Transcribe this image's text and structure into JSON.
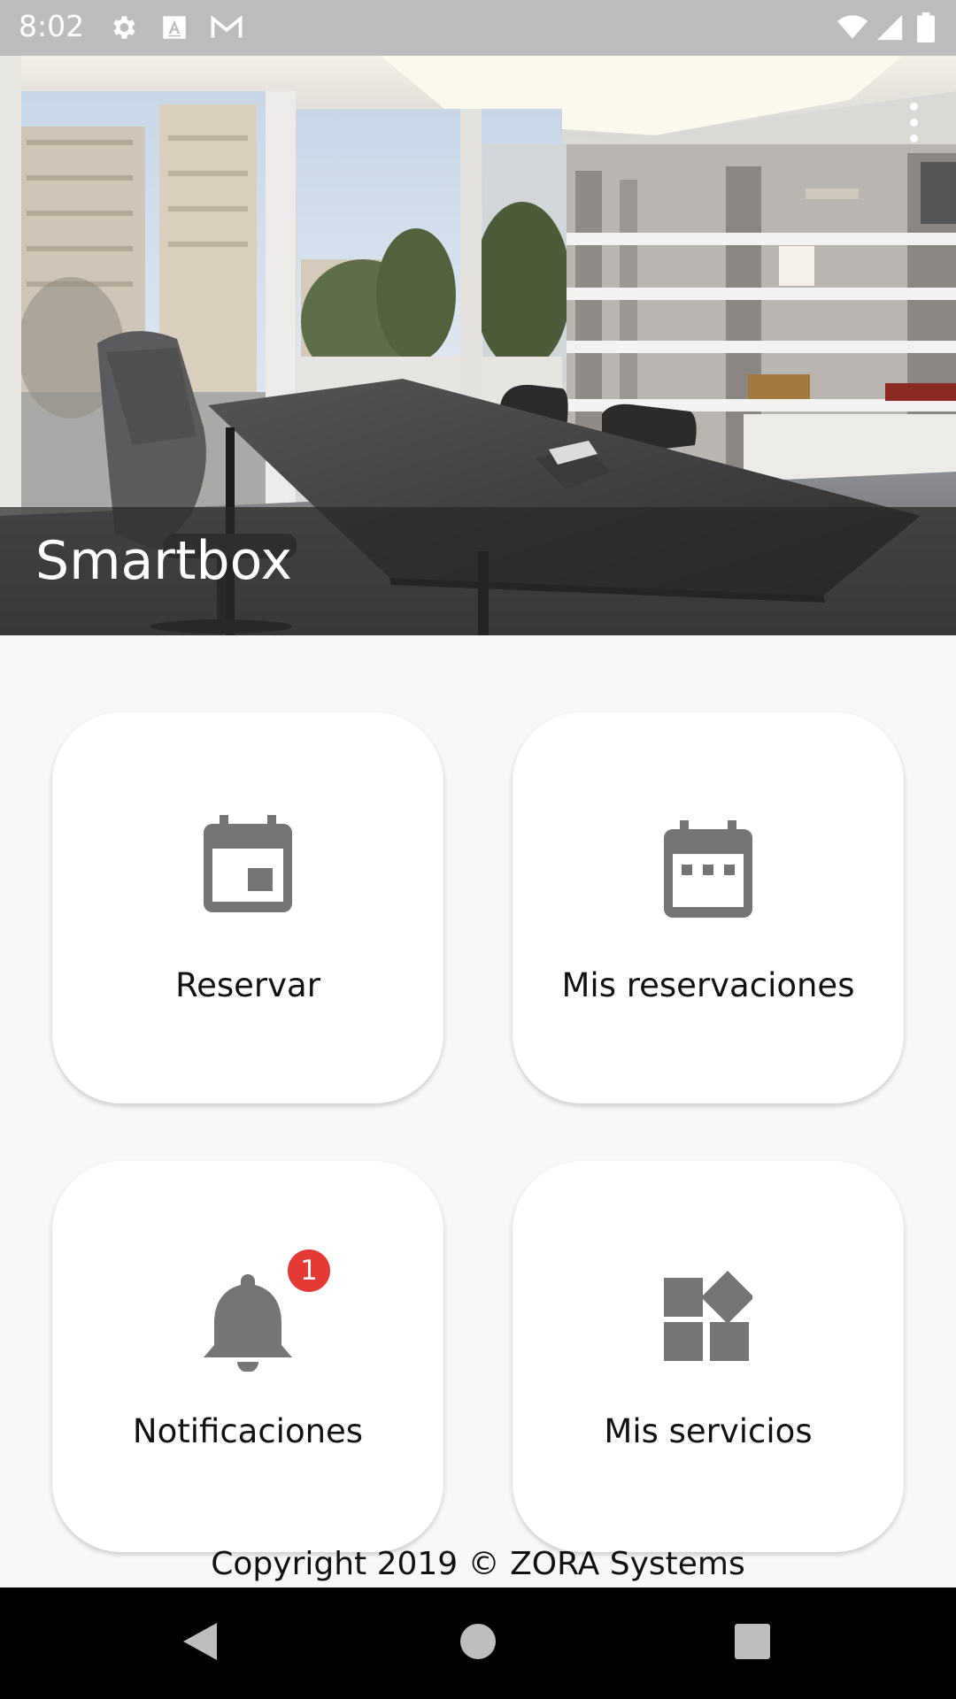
{
  "status_bar": {
    "time": "8:02",
    "left_icons": [
      "gear-icon",
      "font-a-icon",
      "gmail-icon"
    ],
    "right_icons": [
      "wifi-icon",
      "signal-icon",
      "battery-icon"
    ]
  },
  "header": {
    "title": "Smartbox",
    "menu_icon": "more-vert-icon"
  },
  "cards": [
    {
      "label": "Reservar",
      "icon": "calendar-today-icon"
    },
    {
      "label": "Mis reservaciones",
      "icon": "calendar-dots-icon"
    },
    {
      "label": "Notificaciones",
      "icon": "bell-icon",
      "badge": "1"
    },
    {
      "label": "Mis servicios",
      "icon": "widgets-icon"
    }
  ],
  "footer": {
    "copyright": "Copyright 2019 © ZORA Systems"
  },
  "nav_bar": {
    "buttons": [
      "back-icon",
      "home-icon",
      "recents-icon"
    ]
  },
  "colors": {
    "status_bar": "#bdbdbd",
    "icon_gray": "#757575",
    "badge_red": "#e53935",
    "card_bg": "#ffffff",
    "page_bg": "#f8f8f8"
  }
}
